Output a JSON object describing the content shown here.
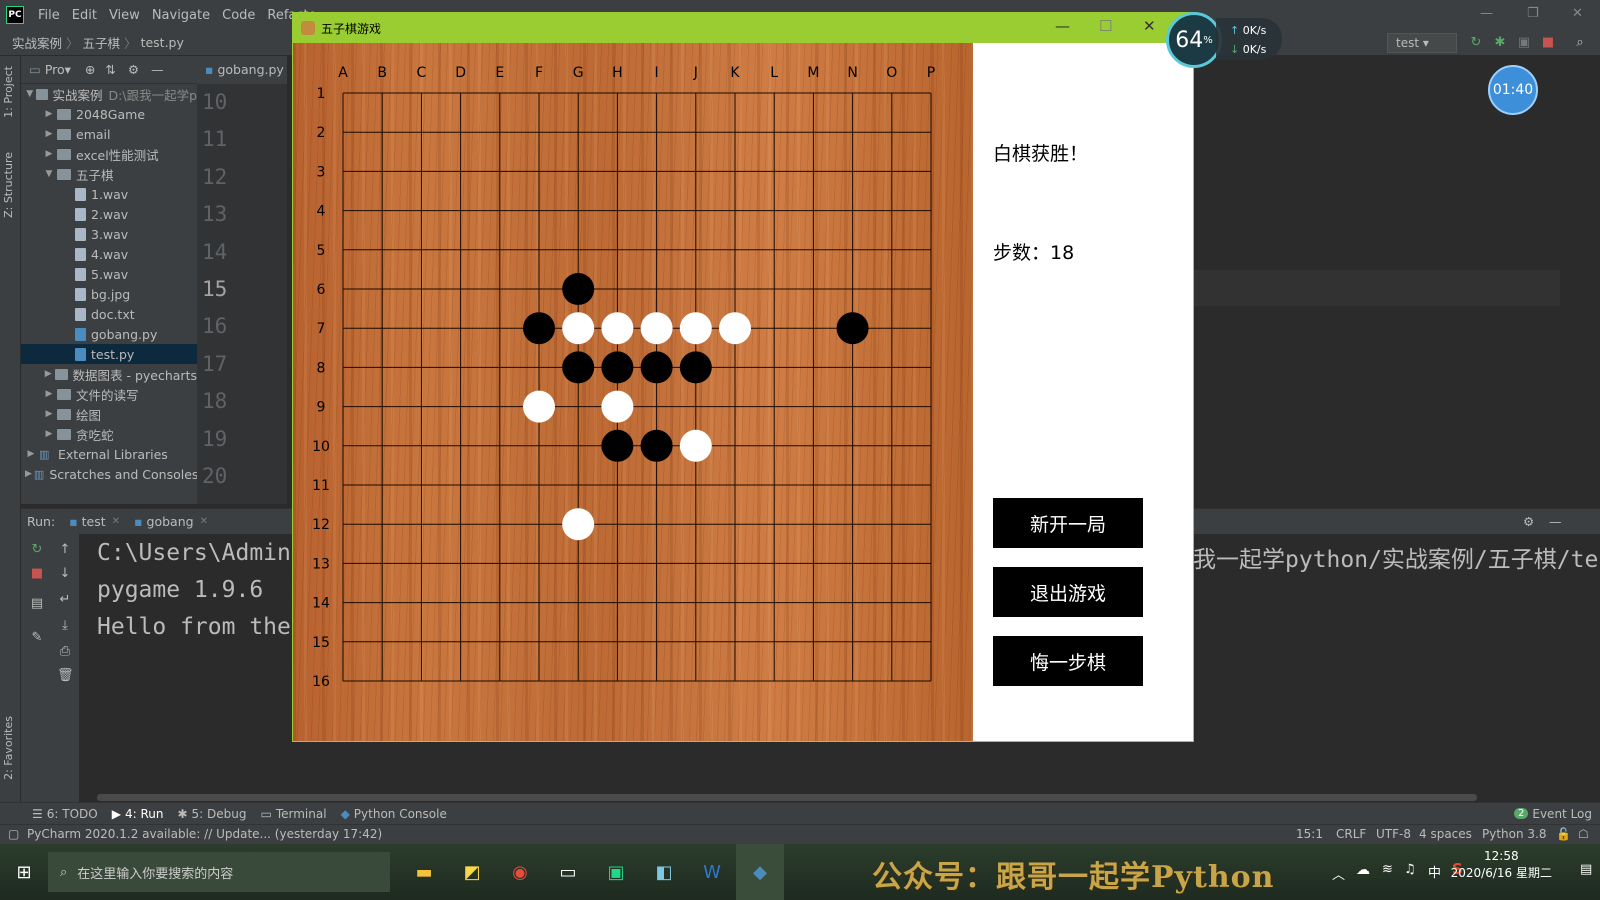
{
  "ide": {
    "menu": [
      "File",
      "Edit",
      "View",
      "Navigate",
      "Code",
      "Refacto"
    ],
    "breadcrumbs": [
      "实战案例",
      "五子棋",
      "test.py"
    ],
    "run_config": "test",
    "project_label": "Pro▾",
    "editor_tab": "gobang.py",
    "left_tabs": [
      "1: Project",
      "Z: Structure",
      "2: Favorites"
    ],
    "tree": [
      {
        "label": "实战案例",
        "suffix": "D:\\跟我一起学p",
        "level": 0,
        "type": "folder",
        "open": true
      },
      {
        "label": "2048Game",
        "level": 1,
        "type": "folder"
      },
      {
        "label": "email",
        "level": 1,
        "type": "folder"
      },
      {
        "label": "excel性能测试",
        "level": 1,
        "type": "folder"
      },
      {
        "label": "五子棋",
        "level": 1,
        "type": "folder",
        "open": true
      },
      {
        "label": "1.wav",
        "level": 2,
        "type": "file"
      },
      {
        "label": "2.wav",
        "level": 2,
        "type": "file"
      },
      {
        "label": "3.wav",
        "level": 2,
        "type": "file"
      },
      {
        "label": "4.wav",
        "level": 2,
        "type": "file"
      },
      {
        "label": "5.wav",
        "level": 2,
        "type": "file"
      },
      {
        "label": "bg.jpg",
        "level": 2,
        "type": "file"
      },
      {
        "label": "doc.txt",
        "level": 2,
        "type": "file"
      },
      {
        "label": "gobang.py",
        "level": 2,
        "type": "py"
      },
      {
        "label": "test.py",
        "level": 2,
        "type": "py",
        "selected": true
      },
      {
        "label": "数据图表 - pyecharts",
        "level": 1,
        "type": "folder"
      },
      {
        "label": "文件的读写",
        "level": 1,
        "type": "folder"
      },
      {
        "label": "绘图",
        "level": 1,
        "type": "folder"
      },
      {
        "label": "贪吃蛇",
        "level": 1,
        "type": "folder"
      },
      {
        "label": "External Libraries",
        "level": 0,
        "type": "lib"
      },
      {
        "label": "Scratches and Consoles",
        "level": 0,
        "type": "lib"
      }
    ],
    "line_numbers": [
      "10",
      "11",
      "12",
      "13",
      "14",
      "15",
      "16",
      "17",
      "18",
      "19",
      "20"
    ],
    "current_line": "15",
    "run_label": "Run:",
    "run_tabs": [
      "test",
      "gobang"
    ],
    "console_lines": [
      "C:\\Users\\Admin",
      "pygame 1.9.6",
      "Hello from the"
    ],
    "console_right": "我一起学python/实战案例/五子棋/te",
    "tool_buttons": [
      "6: TODO",
      "4: Run",
      "5: Debug",
      "Terminal",
      "Python Console"
    ],
    "event_log": "Event Log",
    "event_count": "2",
    "status_left": "PyCharm 2020.1.2 available: // Update... (yesterday 17:42)",
    "status_right": [
      "15:1",
      "CRLF",
      "UTF-8",
      "4 spaces",
      "Python 3.8"
    ]
  },
  "overlay": {
    "cpu_percent": "64",
    "cpu_unit": "%",
    "net_up": "0K/s",
    "net_down": "0K/s",
    "timer": "01:40"
  },
  "game": {
    "title": "五子棋游戏",
    "status": "白棋获胜！",
    "steps_label": "步数：",
    "steps": "18",
    "buttons": {
      "new_game": "新开一局",
      "quit": "退出游戏",
      "undo": "悔一步棋"
    },
    "col_labels": [
      "A",
      "B",
      "C",
      "D",
      "E",
      "F",
      "G",
      "H",
      "I",
      "J",
      "K",
      "L",
      "M",
      "N",
      "O",
      "P"
    ],
    "row_labels": [
      "1",
      "2",
      "3",
      "4",
      "5",
      "6",
      "7",
      "8",
      "9",
      "10",
      "11",
      "12",
      "13",
      "14",
      "15",
      "16"
    ],
    "stones": [
      {
        "col": "G",
        "row": 6,
        "color": "black"
      },
      {
        "col": "F",
        "row": 7,
        "color": "black"
      },
      {
        "col": "G",
        "row": 7,
        "color": "white"
      },
      {
        "col": "H",
        "row": 7,
        "color": "white"
      },
      {
        "col": "I",
        "row": 7,
        "color": "white"
      },
      {
        "col": "J",
        "row": 7,
        "color": "white"
      },
      {
        "col": "K",
        "row": 7,
        "color": "white"
      },
      {
        "col": "N",
        "row": 7,
        "color": "black"
      },
      {
        "col": "G",
        "row": 8,
        "color": "black"
      },
      {
        "col": "H",
        "row": 8,
        "color": "black"
      },
      {
        "col": "I",
        "row": 8,
        "color": "black"
      },
      {
        "col": "J",
        "row": 8,
        "color": "black"
      },
      {
        "col": "F",
        "row": 9,
        "color": "white"
      },
      {
        "col": "H",
        "row": 9,
        "color": "white"
      },
      {
        "col": "H",
        "row": 10,
        "color": "black"
      },
      {
        "col": "I",
        "row": 10,
        "color": "black"
      },
      {
        "col": "J",
        "row": 10,
        "color": "white"
      },
      {
        "col": "G",
        "row": 12,
        "color": "white"
      }
    ]
  },
  "taskbar": {
    "search_placeholder": "在这里输入你要搜索的内容",
    "watermark": "公众号：跟哥一起学Python",
    "time": "12:58",
    "date": "2020/6/16 星期二",
    "ime": "中"
  }
}
